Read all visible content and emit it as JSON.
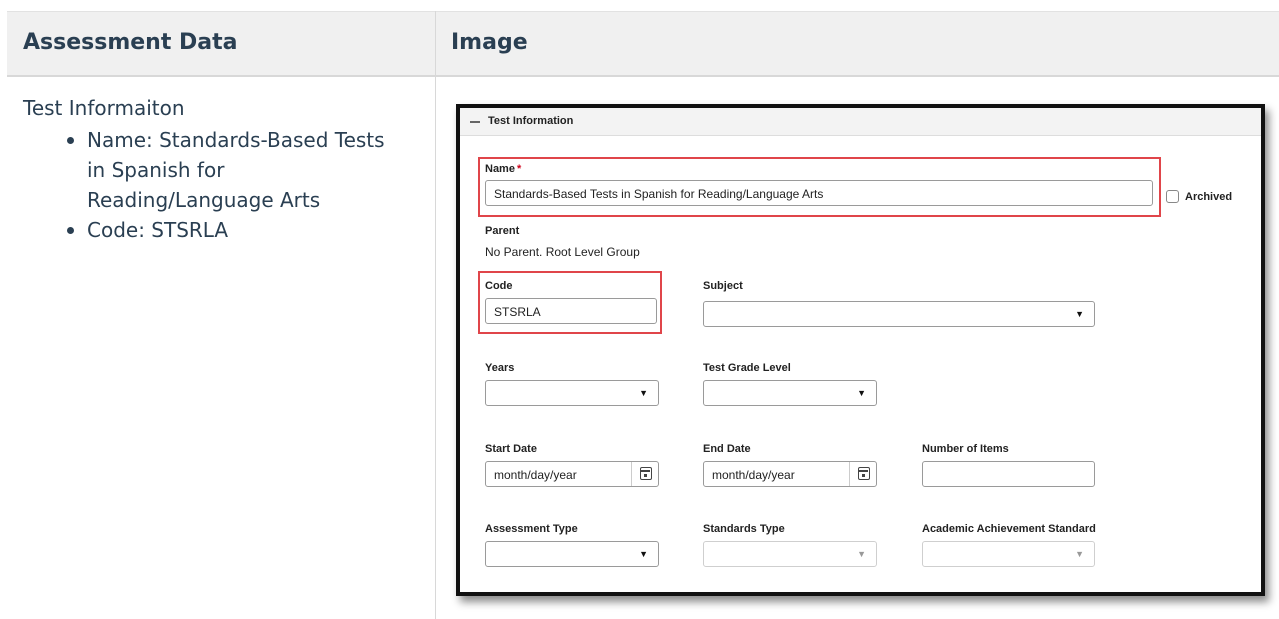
{
  "table": {
    "headers": [
      "Assessment Data",
      "Image"
    ]
  },
  "left": {
    "lead": "Test Informaiton",
    "items": [
      "Name: Standards-Based Tests in Spanish for Reading/Language Arts",
      "Code: STSRLA"
    ]
  },
  "form": {
    "section_title": "Test Information",
    "name_label": "Name",
    "required_mark": "*",
    "name_value": "Standards-Based Tests in Spanish for Reading/Language Arts",
    "archived_label": "Archived",
    "parent_label": "Parent",
    "parent_value": "No Parent. Root Level Group",
    "code_label": "Code",
    "code_value": "STSRLA",
    "subject_label": "Subject",
    "years_label": "Years",
    "grade_label": "Test Grade Level",
    "start_label": "Start Date",
    "start_placeholder": "month/day/year",
    "end_label": "End Date",
    "end_placeholder": "month/day/year",
    "items_label": "Number of Items",
    "assessment_type_label": "Assessment Type",
    "standards_type_label": "Standards Type",
    "achievement_label": "Academic Achievement Standard",
    "caret": "▼"
  },
  "colors": {
    "highlight": "#e0454a",
    "header_text": "#2a3f52",
    "required": "#d0021b"
  }
}
